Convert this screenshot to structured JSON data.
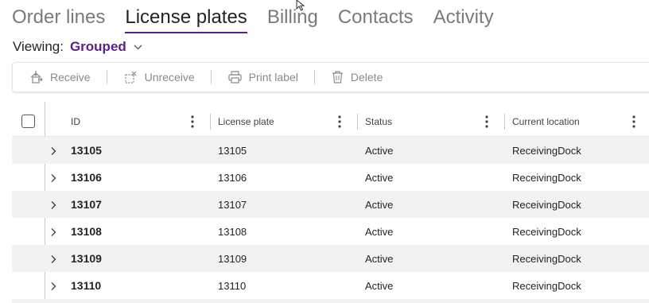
{
  "tabs": [
    {
      "label": "Order lines",
      "active": false
    },
    {
      "label": "License plates",
      "active": true
    },
    {
      "label": "Billing",
      "active": false
    },
    {
      "label": "Contacts",
      "active": false
    },
    {
      "label": "Activity",
      "active": false
    }
  ],
  "viewing": {
    "label": "Viewing:",
    "value": "Grouped"
  },
  "toolbar": {
    "receive": "Receive",
    "unreceive": "Unreceive",
    "print_label": "Print label",
    "delete": "Delete"
  },
  "table": {
    "columns": [
      "ID",
      "License plate",
      "Status",
      "Current location"
    ],
    "rows": [
      {
        "id": "13105",
        "plate": "13105",
        "status": "Active",
        "location": "ReceivingDock"
      },
      {
        "id": "13106",
        "plate": "13106",
        "status": "Active",
        "location": "ReceivingDock"
      },
      {
        "id": "13107",
        "plate": "13107",
        "status": "Active",
        "location": "ReceivingDock"
      },
      {
        "id": "13108",
        "plate": "13108",
        "status": "Active",
        "location": "ReceivingDock"
      },
      {
        "id": "13109",
        "plate": "13109",
        "status": "Active",
        "location": "ReceivingDock"
      },
      {
        "id": "13110",
        "plate": "13110",
        "status": "Active",
        "location": "ReceivingDock"
      }
    ]
  },
  "colors": {
    "accent": "#5b1e8f",
    "row_alt": "#f2f2f2",
    "muted": "#8a8a8a"
  }
}
